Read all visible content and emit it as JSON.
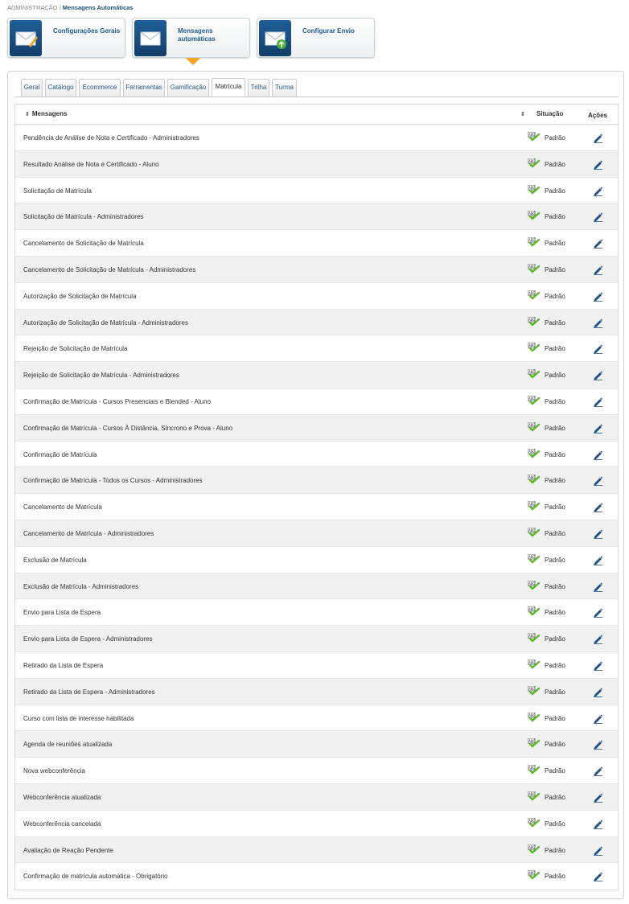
{
  "breadcrumb": {
    "root": "ADMINISTRAÇÃO",
    "separator": "/",
    "current": "Mensagens Automáticas"
  },
  "cards": [
    {
      "label": "Configurações Gerais",
      "icon": "envelope-edit-icon"
    },
    {
      "label": "Mensagens automáticas",
      "icon": "envelope-icon"
    },
    {
      "label": "Configurar Envio",
      "icon": "envelope-send-icon"
    }
  ],
  "tabs": [
    "Geral",
    "Catálogo",
    "Ecommerce",
    "Ferramentas",
    "Gamificação",
    "Matrícula",
    "Trilha",
    "Turma"
  ],
  "active_tab": "Matrícula",
  "table": {
    "headers": {
      "messages": "Mensagens",
      "status": "Situação",
      "actions": "Ações"
    },
    "rows": [
      {
        "name": "Pendência de Análise de Nota e Certificado - Administradores",
        "status": "Padrão"
      },
      {
        "name": "Resultado Análise de Nota e Certificado - Aluno",
        "status": "Padrão"
      },
      {
        "name": "Solicitação de Matrícula",
        "status": "Padrão"
      },
      {
        "name": "Solicitação de Matrícula - Administradores",
        "status": "Padrão"
      },
      {
        "name": "Cancelamento de Solicitação de Matrícula",
        "status": "Padrão"
      },
      {
        "name": "Cancelamento de Solicitação de Matrícula - Administradores",
        "status": "Padrão"
      },
      {
        "name": "Autorização de Solicitação de Matrícula",
        "status": "Padrão"
      },
      {
        "name": "Autorização de Solicitação de Matrícula - Administradores",
        "status": "Padrão"
      },
      {
        "name": "Rejeição de Solicitação de Matrícula",
        "status": "Padrão"
      },
      {
        "name": "Rejeição de Solicitação de Matrícula - Administradores",
        "status": "Padrão"
      },
      {
        "name": "Confirmação de Matrícula - Cursos Presenciais e Blended - Aluno",
        "status": "Padrão"
      },
      {
        "name": "Confirmação de Matrícula - Cursos À Distância, Síncrono e Prova - Aluno",
        "status": "Padrão"
      },
      {
        "name": "Confirmação de Matrícula",
        "status": "Padrão"
      },
      {
        "name": "Confirmação de Matrícula - Todos os Cursos - Administradores",
        "status": "Padrão"
      },
      {
        "name": "Cancelamento de Matrícula",
        "status": "Padrão"
      },
      {
        "name": "Cancelamento de Matrícula - Administradores",
        "status": "Padrão"
      },
      {
        "name": "Exclusão de Matrícula",
        "status": "Padrão"
      },
      {
        "name": "Exclusão de Matrícula - Administradores",
        "status": "Padrão"
      },
      {
        "name": "Envio para Lista de Espera",
        "status": "Padrão"
      },
      {
        "name": "Envio para Lista de Espera - Administradores",
        "status": "Padrão"
      },
      {
        "name": "Retirado da Lista de Espera",
        "status": "Padrão"
      },
      {
        "name": "Retirado da Lista de Espera - Administradores",
        "status": "Padrão"
      },
      {
        "name": "Curso com lista de interesse habilitada",
        "status": "Padrão"
      },
      {
        "name": "Agenda de reuniões atualizada",
        "status": "Padrão"
      },
      {
        "name": "Nova webconferência",
        "status": "Padrão"
      },
      {
        "name": "Webconferência atualizada",
        "status": "Padrão"
      },
      {
        "name": "Webconferência cancelada",
        "status": "Padrão"
      },
      {
        "name": "Avaliação de Reação Pendente",
        "status": "Padrão"
      },
      {
        "name": "Confirmação de matrícula automática - Obrigatório",
        "status": "Padrão"
      }
    ]
  },
  "colors": {
    "brand": "#1f5f98",
    "accent": "#f5a523",
    "link": "#2b5e8e",
    "status_icon": "#5cb82a",
    "edit_icon": "#1e4f8a"
  }
}
